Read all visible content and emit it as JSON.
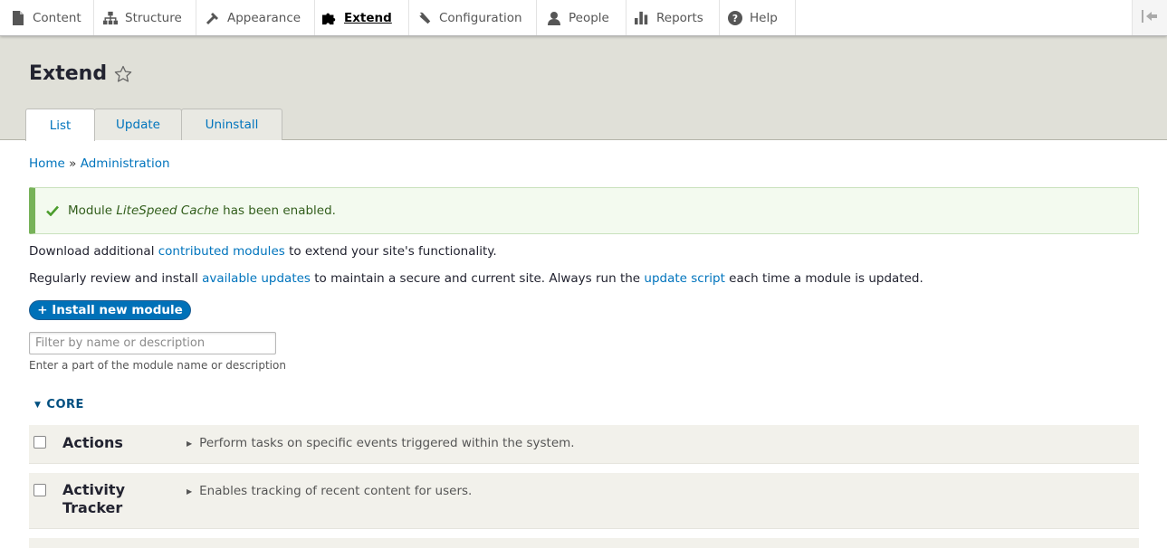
{
  "toolbar": {
    "items": [
      {
        "label": "Content",
        "icon": "content-icon"
      },
      {
        "label": "Structure",
        "icon": "structure-icon"
      },
      {
        "label": "Appearance",
        "icon": "appearance-icon"
      },
      {
        "label": "Extend",
        "icon": "extend-icon",
        "active": true
      },
      {
        "label": "Configuration",
        "icon": "wrench-icon"
      },
      {
        "label": "People",
        "icon": "people-icon"
      },
      {
        "label": "Reports",
        "icon": "reports-icon"
      },
      {
        "label": "Help",
        "icon": "help-icon"
      }
    ],
    "collapse_icon": "collapse-toolbar-icon"
  },
  "page": {
    "title": "Extend",
    "tabs": [
      {
        "label": "List",
        "active": true
      },
      {
        "label": "Update"
      },
      {
        "label": "Uninstall"
      }
    ]
  },
  "breadcrumb": {
    "home": "Home",
    "separator": "»",
    "admin": "Administration"
  },
  "status_message": {
    "prefix": "Module ",
    "module": "LiteSpeed Cache",
    "suffix": " has been enabled."
  },
  "intro": {
    "line1_a": "Download additional ",
    "line1_link": "contributed modules",
    "line1_b": " to extend your site's functionality.",
    "line2_a": "Regularly review and install ",
    "line2_link1": "available updates",
    "line2_b": " to maintain a secure and current site. Always run the ",
    "line2_link2": "update script",
    "line2_c": " each time a module is updated."
  },
  "install_button": "+ Install new module",
  "filter": {
    "placeholder": "Filter by name or description",
    "hint": "Enter a part of the module name or description"
  },
  "package": {
    "name": "CORE",
    "modules": [
      {
        "name": "Actions",
        "description": "Perform tasks on specific events triggered within the system."
      },
      {
        "name_line1": "Activity",
        "name_line2": "Tracker",
        "description": "Enables tracking of recent content for users."
      }
    ]
  },
  "colors": {
    "link": "#0074bd",
    "header_bg": "#e0e0d8",
    "success_border": "#77b259",
    "primary_button": "#0071b8"
  }
}
